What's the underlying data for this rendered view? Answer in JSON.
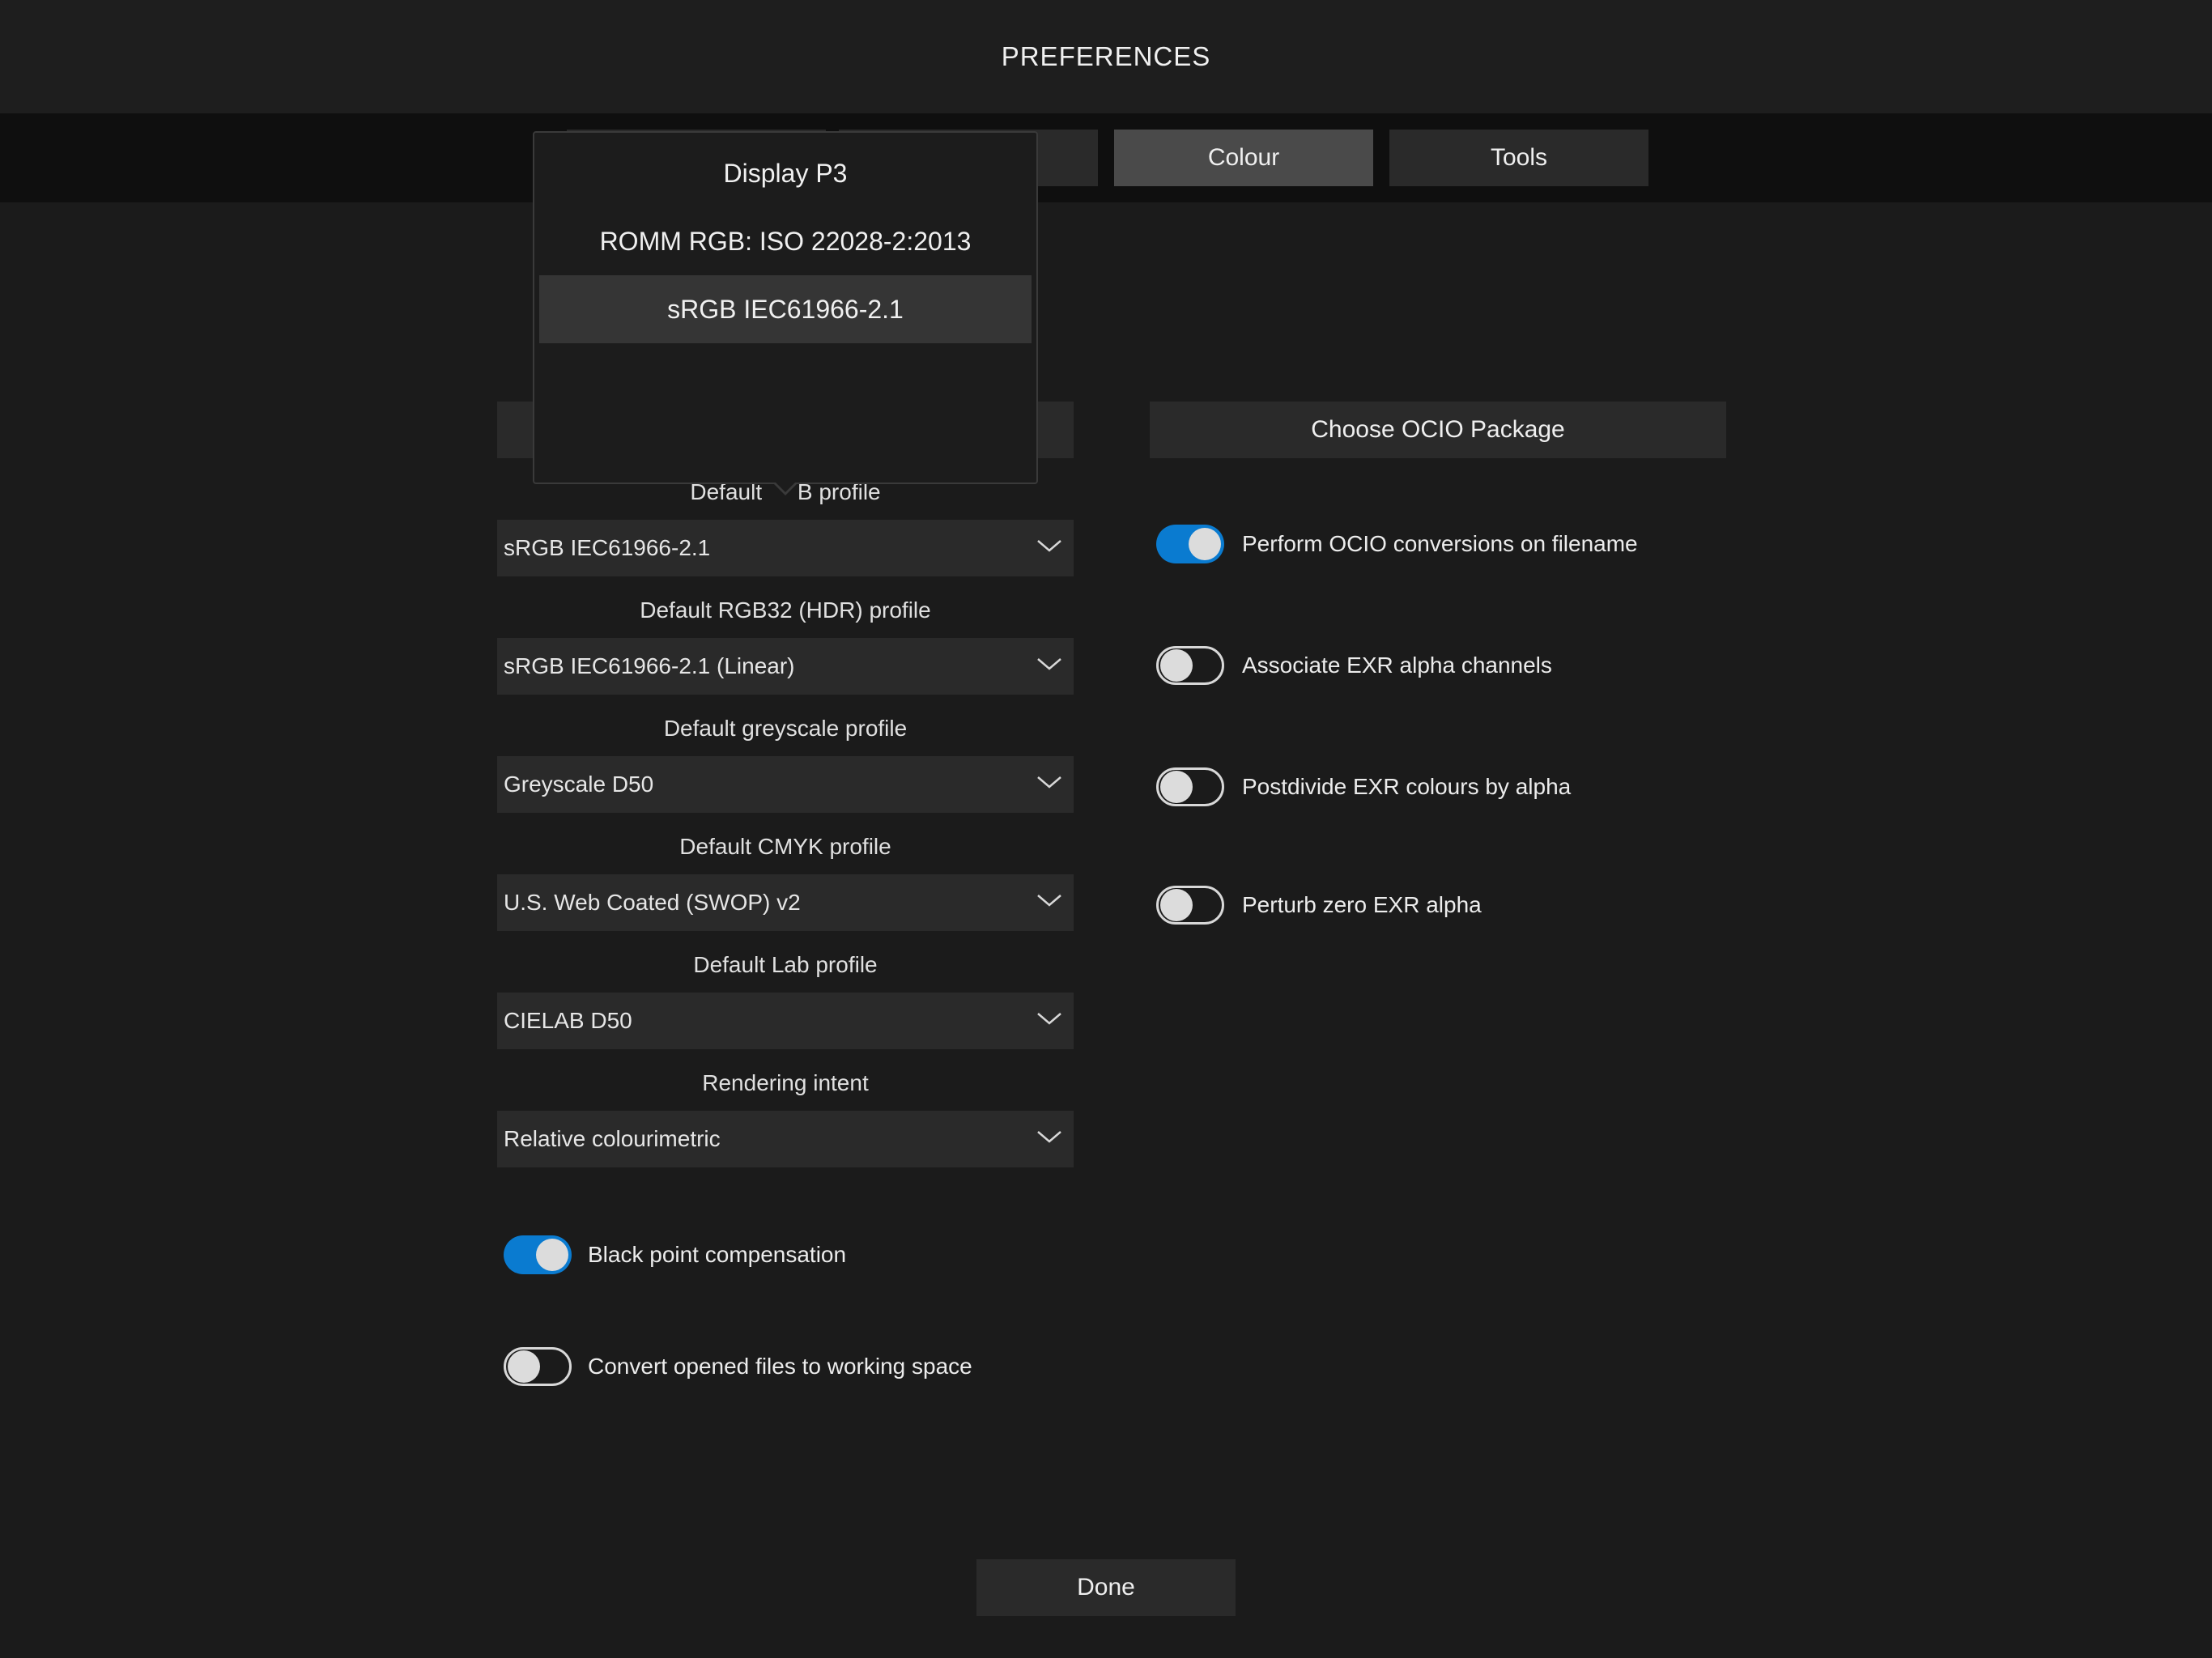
{
  "header": {
    "title": "PREFERENCES"
  },
  "tabs": [
    {
      "label": "Colour",
      "active": true
    },
    {
      "label": "Tools",
      "active": false
    }
  ],
  "profile_menu": {
    "options": [
      "Display P3",
      "ROMM RGB: ISO 22028-2:2013",
      "sRGB IEC61966-2.1"
    ],
    "selected": "sRGB IEC61966-2.1"
  },
  "left": {
    "rgb_label_visible": "Default ",
    "rgb_label_tail": "B profile",
    "rgb_value": "sRGB IEC61966-2.1",
    "rgb32_label": "Default RGB32 (HDR) profile",
    "rgb32_value": "sRGB IEC61966-2.1 (Linear)",
    "grey_label": "Default greyscale profile",
    "grey_value": "Greyscale D50",
    "cmyk_label": "Default CMYK profile",
    "cmyk_value": "U.S. Web Coated (SWOP) v2",
    "lab_label": "Default Lab profile",
    "lab_value": "CIELAB D50",
    "intent_label": "Rendering intent",
    "intent_value": "Relative colourimetric",
    "black_point_label": "Black point compensation",
    "black_point_on": true,
    "convert_label": "Convert opened files to working space",
    "convert_on": false
  },
  "right": {
    "ocio_button": "Choose OCIO Package",
    "toggles": [
      {
        "label": "Perform OCIO conversions on filename",
        "on": true
      },
      {
        "label": "Associate EXR alpha channels",
        "on": false
      },
      {
        "label": "Postdivide EXR colours by alpha",
        "on": false
      },
      {
        "label": "Perturb zero EXR alpha",
        "on": false
      }
    ]
  },
  "footer": {
    "done_label": "Done"
  },
  "colors": {
    "accent": "#0a7bd0",
    "background": "#1b1b1b",
    "control": "#2a2a2a"
  }
}
